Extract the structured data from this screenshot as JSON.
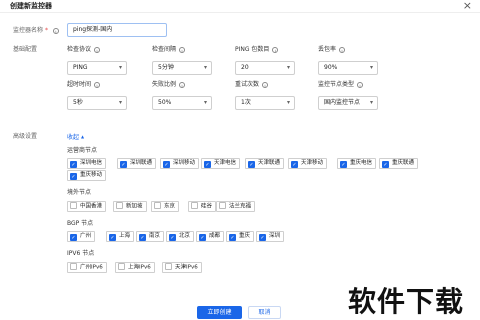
{
  "dialog": {
    "title": "创建新监控器",
    "close": "×"
  },
  "name_row": {
    "label": "监控器名称",
    "required_mark": "*",
    "value": "ping探测-国内"
  },
  "basic": {
    "label": "基础配置",
    "fields": [
      {
        "label": "检查协议",
        "value": "PING",
        "dropdown": true
      },
      {
        "label": "检查间隔",
        "value": "5分钟",
        "dropdown": true
      },
      {
        "label": "PING 包数目",
        "value": "20",
        "dropdown": true
      },
      {
        "label": "丢包率",
        "value": "90%",
        "dropdown": true
      },
      {
        "label": "超时时间",
        "value": "5秒",
        "dropdown": true
      },
      {
        "label": "失败比例",
        "value": "50%",
        "dropdown": true
      },
      {
        "label": "重试次数",
        "value": "1次",
        "dropdown": true
      },
      {
        "label": "监控节点类型",
        "value": "国内监控节点",
        "dropdown": true
      }
    ]
  },
  "advanced": {
    "label": "高级设置",
    "collapse_text": "收起",
    "collapse_arrow": "▲"
  },
  "groups": {
    "carrier": {
      "title": "运营商节点",
      "items": [
        {
          "label": "深圳电信",
          "checked": true
        },
        {
          "label": "深圳联通",
          "checked": true
        },
        {
          "label": "深圳移动",
          "checked": true
        },
        {
          "label": "天津电信",
          "checked": true
        },
        {
          "label": "天津联通",
          "checked": true
        },
        {
          "label": "天津移动",
          "checked": true
        },
        {
          "label": "重庆电信",
          "checked": true
        },
        {
          "label": "重庆联通",
          "checked": true
        },
        {
          "label": "重庆移动",
          "checked": true
        }
      ]
    },
    "overseas": {
      "title": "境外节点",
      "items": [
        {
          "label": "中国香港",
          "checked": false
        },
        {
          "label": "新加坡",
          "checked": false
        },
        {
          "label": "东京",
          "checked": false
        },
        {
          "label": "硅谷",
          "checked": false
        },
        {
          "label": "法兰克福",
          "checked": false
        }
      ]
    },
    "bgp": {
      "title": "BGP 节点",
      "items": [
        {
          "label": "广州",
          "checked": true
        },
        {
          "label": "上海",
          "checked": true
        },
        {
          "label": "南京",
          "checked": true
        },
        {
          "label": "北京",
          "checked": true
        },
        {
          "label": "成都",
          "checked": true
        },
        {
          "label": "重庆",
          "checked": true
        },
        {
          "label": "深圳",
          "checked": true
        }
      ]
    },
    "ipv6": {
      "title": "IPV6 节点",
      "items": [
        {
          "label": "广州IPv6",
          "checked": false
        },
        {
          "label": "上海IPv6",
          "checked": false
        },
        {
          "label": "天津IPv6",
          "checked": false
        }
      ]
    }
  },
  "footer": {
    "create": "立即创建",
    "cancel": "取消"
  },
  "checkmark": "✓",
  "info_glyph": "i",
  "watermark": "软件下载",
  "colors": {
    "primary": "#1a66e8",
    "required": "#e54545"
  }
}
